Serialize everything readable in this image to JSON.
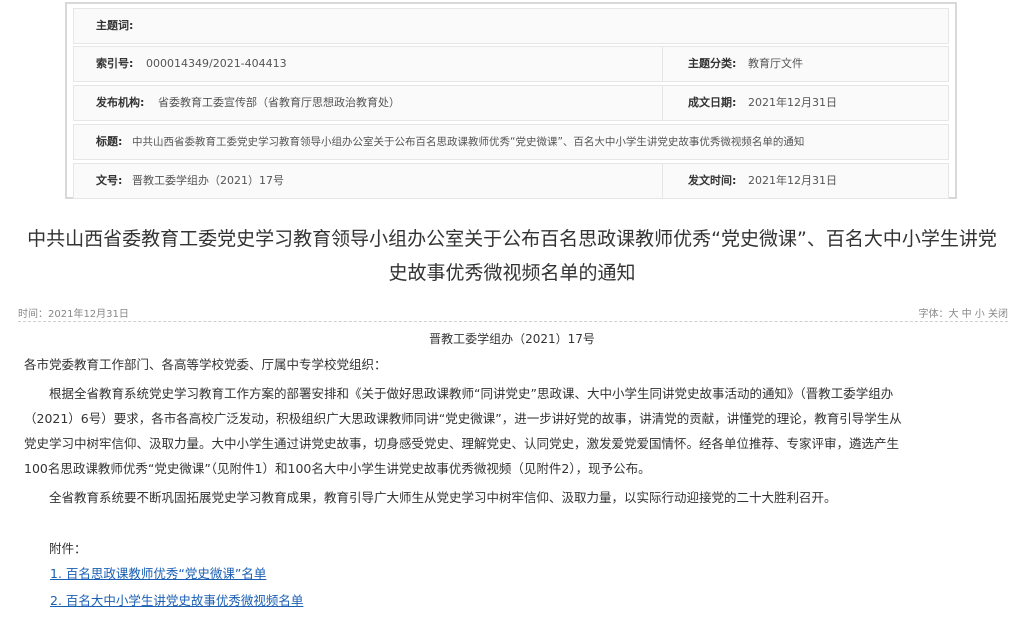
{
  "meta": {
    "topic_label": "主题词:",
    "topic_value": "",
    "index_label": "索引号:",
    "index_value": "000014349/2021-404413",
    "category_label": "主题分类:",
    "category_value": "教育厅文件",
    "publisher_label": "发布机构:",
    "publisher_value": "省委教育工委宣传部（省教育厅思想政治教育处）",
    "date_label": "成文日期:",
    "date_value": "2021年12月31日",
    "subject_label": "标题:",
    "subject_value": "中共山西省委教育工委党史学习教育领导小组办公室关于公布百名思政课教师优秀“党史微课”、百名大中小学生讲党史故事优秀微视频名单的通知",
    "docnum_label": "文号:",
    "docnum_value": "晋教工委学组办（2021）17号",
    "pubtime_label": "发文时间:",
    "pubtime_value": "2021年12月31日"
  },
  "article": {
    "title_line1": "中共山西省委教育工委党史学习教育领导小组办公室关于公布百名思政课教师优秀“党史微课”、百名大中小学生讲党",
    "title_line2": "史故事优秀微视频名单的通知",
    "time": "时间：2021年12月31日",
    "font_controls": "字体：大 中 小 关闭",
    "doc_number": "晋教工委学组办（2021）17号",
    "salutation": "各市党委教育工作部门、各高等学校党委、厅属中专学校党组织：",
    "para1_line1": "　　根据全省教育系统党史学习教育工作方案的部署安排和《关于做好思政课教师“同讲党史”思政课、大中小学生同讲党史故事活动的通知》（晋教工委学组办",
    "para1_line2": "（2021）6号）要求，各市各高校广泛发动，积极组织广大思政课教师同讲“党史微课”，进一步讲好党的故事，讲清党的贡献，讲懂党的理论，教育引导学生从",
    "para1_line3": "党史学习中树牢信仰、汲取力量。大中小学生通过讲党史故事，切身感受党史、理解党史、认同党史，激发爱党爱国情怀。经各单位推荐、专家评审，遴选产生",
    "para1_line4": "100名思政课教师优秀“党史微课”（见附件1）和100名大中小学生讲党史故事优秀微视频（见附件2），现予公布。",
    "para2": "　　全省教育系统要不断巩固拓展党史学习教育成果，教育引导广大师生从党史学习中树牢信仰、汲取力量，以实际行动迎接党的二十大胜利召开。",
    "attachments_label": "　　附件：",
    "attachments": [
      "1. 百名思政课教师优秀“党史微课”名单",
      "2. 百名大中小学生讲党史故事优秀微视频名单"
    ]
  }
}
